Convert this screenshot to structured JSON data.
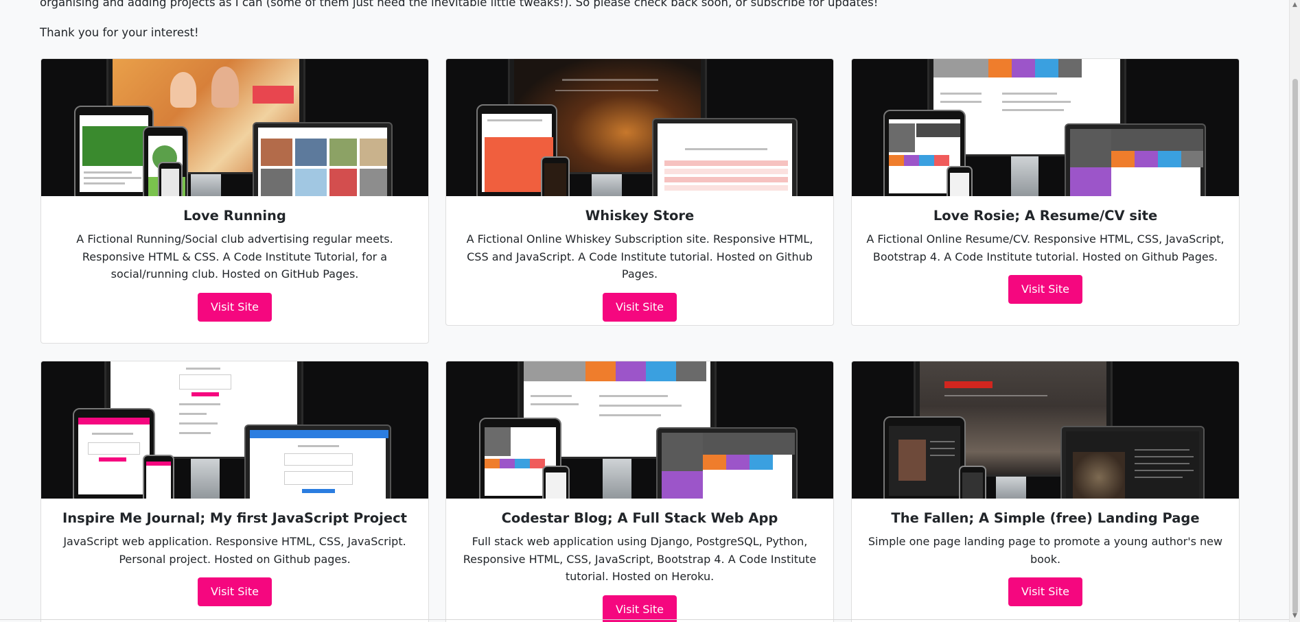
{
  "intro": {
    "paragraph_1": "organising and adding projects as I can (some of them just need the inevitable little tweaks!). So please check back soon, or subscribe for updates!",
    "paragraph_2": "Thank you for your interest!"
  },
  "colors": {
    "accent": "#f5077f",
    "page_background": "#f8f9fa",
    "thumbnail_background": "#0d0d0e"
  },
  "projects": [
    {
      "title": "Love Running",
      "description": "A Fictional Running/Social club advertising regular meets. Responsive HTML & CSS. A Code Institute Tutorial, for a social/running club. Hosted on GitHub Pages.",
      "button": "Visit Site"
    },
    {
      "title": "Whiskey Store",
      "description": "A Fictional Online Whiskey Subscription site. Responsive HTML, CSS and JavaScript. A Code Institute tutorial. Hosted on Github Pages.",
      "button": "Visit Site"
    },
    {
      "title": "Love Rosie; A Resume/CV site",
      "description": "A Fictional Online Resume/CV. Responsive HTML, CSS, JavaScript, Bootstrap 4. A Code Institute tutorial. Hosted on Github Pages.",
      "button": "Visit Site"
    },
    {
      "title": "Inspire Me Journal; My first JavaScript Project",
      "description": "JavaScript web application. Responsive HTML, CSS, JavaScript. Personal project. Hosted on Github pages.",
      "button": "Visit Site"
    },
    {
      "title": "Codestar Blog; A Full Stack Web App",
      "description": "Full stack web application using Django, PostgreSQL, Python, Responsive HTML, CSS, JavaScript, Bootstrap 4. A Code Institute tutorial. Hosted on Heroku.",
      "button": "Visit Site"
    },
    {
      "title": "The Fallen; A Simple (free) Landing Page",
      "description": "Simple one page landing page to promote a young author's new book.",
      "button": "Visit Site"
    }
  ]
}
